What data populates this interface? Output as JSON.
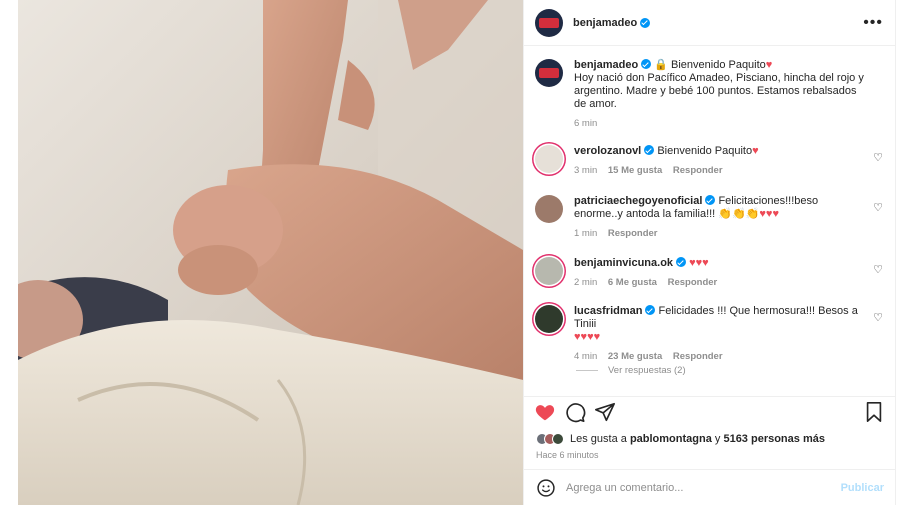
{
  "post": {
    "image_alt": "Adult finger held by a newborn's hand",
    "author": "benjamadeo",
    "more_label": "•••"
  },
  "caption": {
    "username": "benjamadeo",
    "text": "🔒 Bienvenido Paquito",
    "heart": "♥",
    "body": "Hoy nació don Pacífico Amadeo, Pisciano, hincha del rojo y argentino. Madre y bebé 100 puntos. Estamos rebalsados de amor.",
    "time": "6 min"
  },
  "comments": [
    {
      "username": "verolozanovl",
      "text": "Bienvenido Paquito",
      "emojis": "♥",
      "time": "3 min",
      "likes": "15 Me gusta",
      "reply": "Responder"
    },
    {
      "username": "patriciaechegoyenoficial",
      "text": "Felicitaciones!!!beso enorme..y antoda la familia!!!",
      "emojis": "👏👏👏♥♥♥",
      "time": "1 min",
      "likes": "",
      "reply": "Responder"
    },
    {
      "username": "benjaminvicuna.ok",
      "text": "",
      "emojis": "♥♥♥",
      "time": "2 min",
      "likes": "6 Me gusta",
      "reply": "Responder"
    },
    {
      "username": "lucasfridman",
      "text": "Felicidades !!! Que hermosura!!! Besos a Tiniii",
      "emojis": "♥♥♥♥",
      "time": "4 min",
      "likes": "23 Me gusta",
      "reply": "Responder"
    }
  ],
  "view_replies": "Ver respuestas (2)",
  "likes_line": {
    "prefix": "Les gusta a",
    "user": "pablomontagna",
    "conj": "y",
    "count": "5163 personas más"
  },
  "time_ago": "Hace 6 minutos",
  "add_comment": {
    "placeholder": "Agrega un comentario...",
    "publish": "Publicar"
  },
  "colors": {
    "accent": "#0095f6",
    "like": "#ed4956"
  },
  "icons": [
    "heart-icon",
    "comment-icon",
    "share-icon",
    "save-icon",
    "emoji-icon",
    "more-icon",
    "verified-icon"
  ]
}
